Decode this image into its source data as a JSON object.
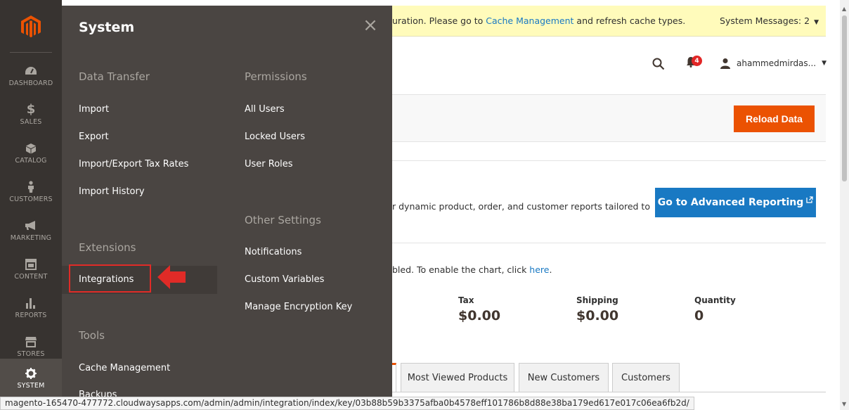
{
  "nav": {
    "items": [
      {
        "label": "DASHBOARD"
      },
      {
        "label": "SALES"
      },
      {
        "label": "CATALOG"
      },
      {
        "label": "CUSTOMERS"
      },
      {
        "label": "MARKETING"
      },
      {
        "label": "CONTENT"
      },
      {
        "label": "REPORTS"
      },
      {
        "label": "STORES"
      },
      {
        "label": "SYSTEM"
      }
    ]
  },
  "flyout": {
    "title": "System",
    "data_transfer": {
      "title": "Data Transfer",
      "items": [
        "Import",
        "Export",
        "Import/Export Tax Rates",
        "Import History"
      ]
    },
    "permissions": {
      "title": "Permissions",
      "items": [
        "All Users",
        "Locked Users",
        "User Roles"
      ]
    },
    "other_settings": {
      "title": "Other Settings",
      "items": [
        "Notifications",
        "Custom Variables",
        "Manage Encryption Key"
      ]
    },
    "extensions": {
      "title": "Extensions",
      "items": [
        "Integrations"
      ]
    },
    "tools": {
      "title": "Tools",
      "items": [
        "Cache Management",
        "Backups"
      ]
    }
  },
  "message_bar": {
    "prefix": "uration. Please go to ",
    "link": "Cache Management",
    "suffix": " and refresh cache types.",
    "system_messages": "System Messages: 2"
  },
  "header": {
    "notifications_count": "4",
    "username": "ahammedmirdas..."
  },
  "actions": {
    "reload": "Reload Data"
  },
  "advanced_reporting": {
    "text": "r dynamic product, order, and customer reports tailored to",
    "button": "Go to Advanced Reporting"
  },
  "chart_note": {
    "text": "bled. To enable the chart, click ",
    "link": "here",
    "end": "."
  },
  "totals": [
    {
      "label": "Tax",
      "value": "$0.00"
    },
    {
      "label": "Shipping",
      "value": "$0.00"
    },
    {
      "label": "Quantity",
      "value": "0"
    }
  ],
  "tabs": [
    "Most Viewed Products",
    "New Customers",
    "Customers"
  ],
  "status_url": "magento-165470-477772.cloudwaysapps.com/admin/admin/integration/index/key/03b88b59b3375afba0b4578eff101786b8d88e38ba179ed617e017c06ea6fb2d/",
  "colors": {
    "accent_orange": "#eb5202",
    "link_blue": "#1979c3",
    "annotation_red": "#e02b27",
    "nav_bg": "#373330"
  }
}
